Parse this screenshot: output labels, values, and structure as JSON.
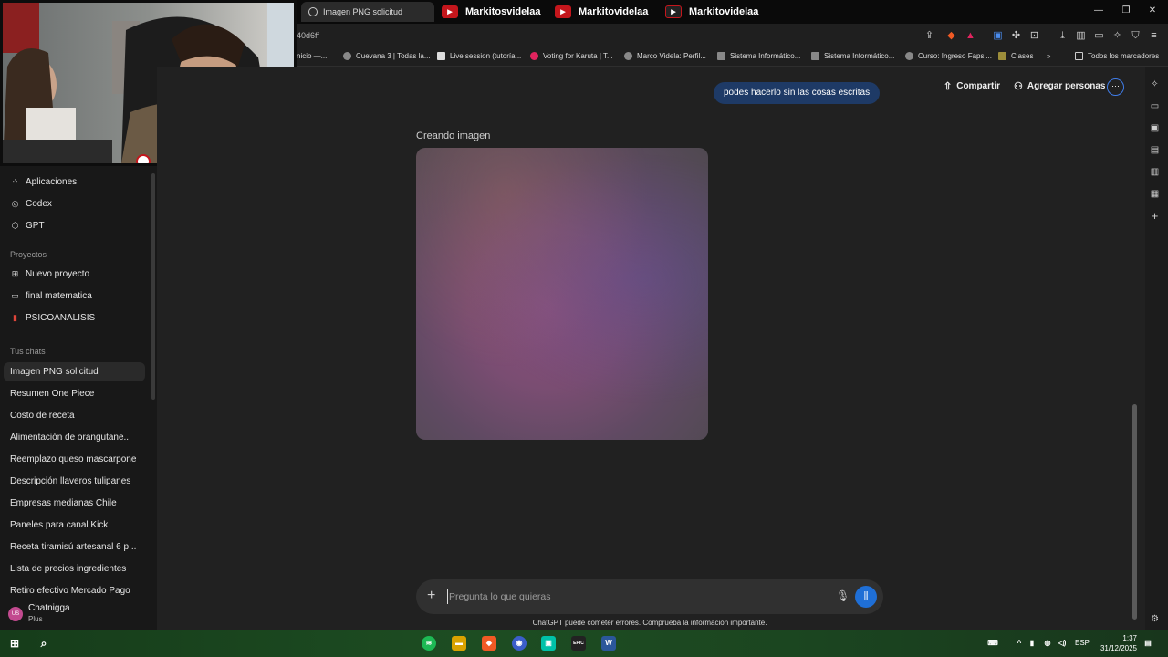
{
  "browser": {
    "tabs": [
      {
        "label": "Imagen PNG solicitud",
        "icon": "chatgpt-icon"
      },
      {
        "label": "Markitosvidelaa",
        "icon": "youtube-icon"
      },
      {
        "label": "Markitovidelaa",
        "icon": "youtube-icon"
      },
      {
        "label": "Markitovidelaa",
        "icon": "youtube-icon"
      }
    ],
    "url_fragment": "40d6ff",
    "bookmarks": [
      {
        "label": "nicio —..."
      },
      {
        "label": "Cuevana 3 | Todas la..."
      },
      {
        "label": "Live session (tutoría..."
      },
      {
        "label": "Voting for Karuta | T..."
      },
      {
        "label": "Marco Videla: Perfil..."
      },
      {
        "label": "Sistema Informático..."
      },
      {
        "label": "Sistema Informático..."
      },
      {
        "label": "Curso: Ingreso Fapsi..."
      },
      {
        "label": "Clases"
      }
    ],
    "bookmarks_more": "»",
    "all_bookmarks": "Todos los marcadores"
  },
  "sidebar": {
    "nav": [
      {
        "label": "Aplicaciones",
        "icon": "apps-icon"
      },
      {
        "label": "Codex",
        "icon": "codex-icon"
      },
      {
        "label": "GPT",
        "icon": "gpt-cube-icon"
      }
    ],
    "projects_heading": "Proyectos",
    "projects": [
      {
        "label": "Nuevo proyecto",
        "icon": "new-folder-icon"
      },
      {
        "label": "final matematica",
        "icon": "folder-icon"
      },
      {
        "label": "PSICOANALISIS",
        "icon": "red-book-icon"
      }
    ],
    "chats_heading": "Tus chats",
    "chats": [
      {
        "label": "Imagen PNG solicitud",
        "selected": true
      },
      {
        "label": "Resumen One Piece"
      },
      {
        "label": "Costo de receta"
      },
      {
        "label": "Alimentación de orangutane..."
      },
      {
        "label": "Reemplazo queso mascarpone"
      },
      {
        "label": "Descripción llaveros tulipanes"
      },
      {
        "label": "Empresas medianas Chile"
      },
      {
        "label": "Paneles para canal Kick"
      },
      {
        "label": "Receta tiramisú artesanal 6 p..."
      },
      {
        "label": "Lista de precios ingredientes"
      },
      {
        "label": "Retiro efectivo Mercado Pago"
      }
    ],
    "user": {
      "initials": "US",
      "name": "Chatnigga",
      "plan": "Plus"
    }
  },
  "main": {
    "share_label": "Compartir",
    "add_people_label": "Agregar personas",
    "more_label": "···",
    "user_message": "podes hacerlo sin las cosas escritas",
    "creating_label": "Creando imagen",
    "composer": {
      "placeholder": "Pregunta lo que quieras",
      "value": ""
    },
    "disclaimer": "ChatGPT puede cometer errores. Comprueba la información importante."
  },
  "taskbar": {
    "language": "ESP",
    "time": "1:37",
    "date": "31/12/2025"
  },
  "colors": {
    "accent": "#1f6fd6",
    "bubble": "#1e3a66",
    "sidebar": "#181818",
    "main_bg": "#212121"
  }
}
